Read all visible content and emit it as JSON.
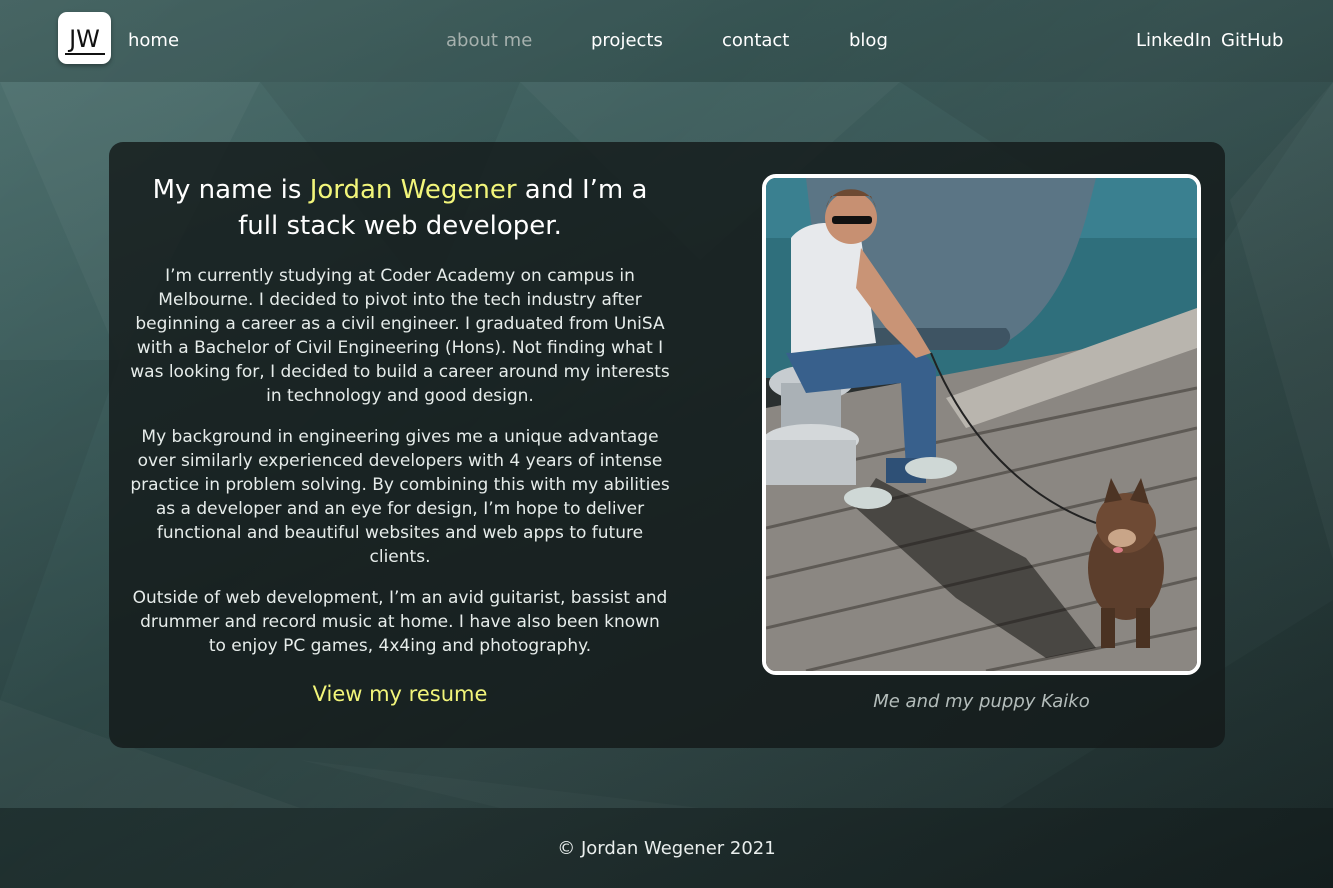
{
  "nav": {
    "logo_text": "JW",
    "home": "home",
    "about": "about me",
    "projects": "projects",
    "contact": "contact",
    "blog": "blog",
    "linkedin": "LinkedIn",
    "github": "GitHub"
  },
  "about": {
    "heading_prefix": "My name is ",
    "name": "Jordan Wegener",
    "heading_suffix": " and I’m a full stack web developer.",
    "paragraphs": [
      "I’m currently studying at Coder Academy on campus in Melbourne. I decided to pivot into the tech industry after beginning a career as a civil engineer. I graduated from UniSA with a Bachelor of Civil Engineering (Hons). Not finding what I was looking for, I decided to build a career around my interests in technology and good design.",
      "My background in engineering gives me a unique advantage over similarly experienced developers with 4 years of intense practice in problem solving. By combining this with my abilities as a developer and an eye for design, I’m hope to deliver functional and beautiful websites and web apps to future clients.",
      "Outside of web development, I’m an avid guitarist, bassist and drummer and record music at home. I have also been known to enjoy PC games, 4x4ing and photography."
    ],
    "resume_link": "View my resume",
    "photo_caption": "Me and my puppy Kaiko"
  },
  "footer": {
    "copyright": "© Jordan Wegener 2021"
  },
  "colors": {
    "accent": "#f2f57a",
    "active_nav": "#a6b1ae"
  }
}
